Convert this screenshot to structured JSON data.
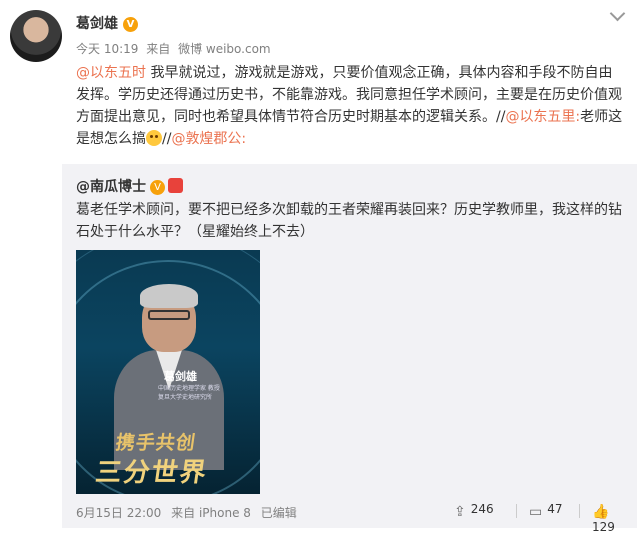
{
  "author": {
    "name": "葛剑雄",
    "verified_glyph": "V"
  },
  "meta": {
    "time": "今天 10:19",
    "source_prefix": "来自",
    "source": "微博 weibo.com"
  },
  "post": {
    "mention1": "@以东五时",
    "text1": " 我早就说过，游戏就是游戏，只要价值观念正确，具体内容和手段不防自由发挥。学历史还得通过历史书，不能靠游戏。我同意担任学术顾问，主要是在历史价值观方面提出意见，同时也希望具体情节符合历史时期基本的逻辑关系。//",
    "mention2": "@以东五里:",
    "text2": "老师这是想怎么搞",
    "text3": "//",
    "mention3": "@敦煌郡公:"
  },
  "repost": {
    "author": "@南瓜博士",
    "verified_glyph": "V",
    "text": "葛老任学术顾问，要不把已经多次卸载的王者荣耀再装回来？历史学教师里，我这样的钻石处于什么水平？（星耀始终上不去）",
    "poster": {
      "name": "葛剑雄",
      "sub1": "中国历史地理学家 教授",
      "sub2": "复旦大学史地研究所",
      "slogan1": "携手共创",
      "slogan2": "三分世界"
    },
    "footer": {
      "date": "6月15日 22:00",
      "source": "来自 iPhone 8",
      "edited": "已编辑",
      "shares": "246",
      "comments": "47",
      "likes": "129"
    }
  },
  "icons": {
    "share": "share-icon",
    "comment": "comment-icon",
    "like": "like-icon",
    "menu": "chevron-down-icon"
  },
  "colors": {
    "mention": "#eb7350",
    "badge": "#f7a10b",
    "repost_bg": "#f2f2f5"
  }
}
